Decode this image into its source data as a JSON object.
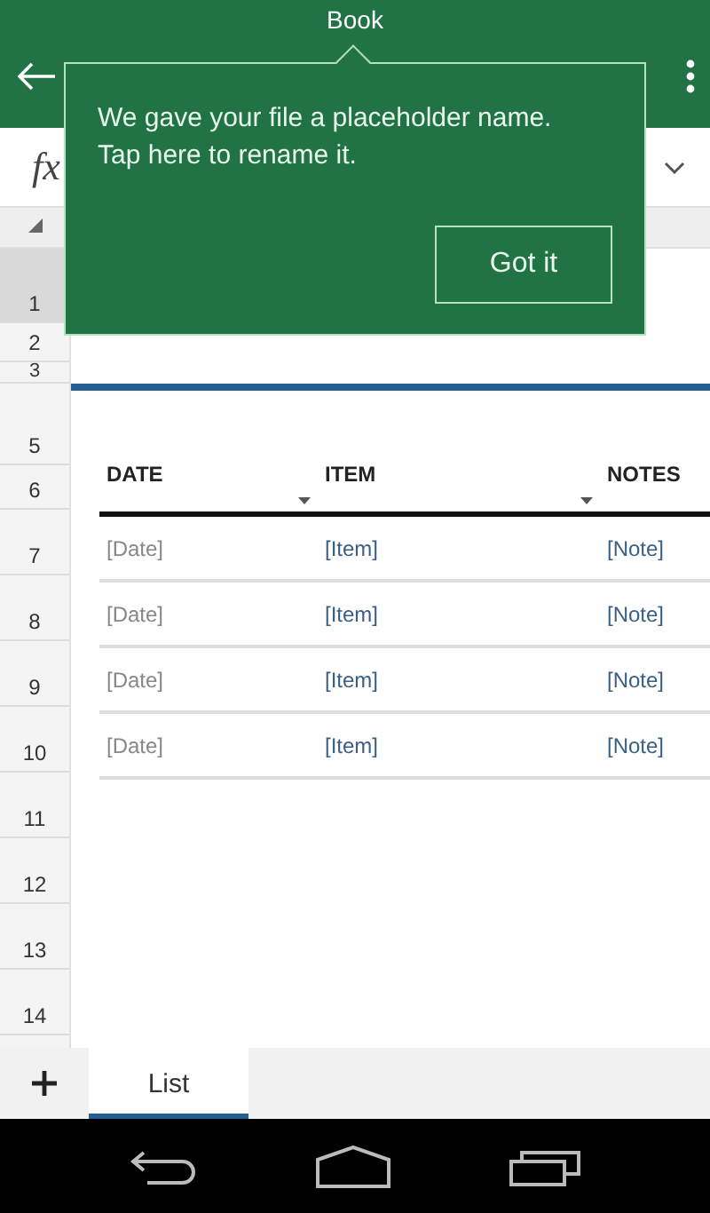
{
  "app_bar": {
    "title": "Book"
  },
  "formula_bar": {
    "function_label": "fx"
  },
  "sheet": {
    "row_headers": [
      {
        "number": "1",
        "selected": true
      },
      {
        "number": "2",
        "selected": false
      },
      {
        "number": "3",
        "selected": false
      },
      {
        "number": "5",
        "selected": false
      },
      {
        "number": "6",
        "selected": false
      },
      {
        "number": "7",
        "selected": false
      },
      {
        "number": "8",
        "selected": false
      },
      {
        "number": "9",
        "selected": false
      },
      {
        "number": "10",
        "selected": false
      },
      {
        "number": "11",
        "selected": false
      },
      {
        "number": "12",
        "selected": false
      },
      {
        "number": "13",
        "selected": false
      },
      {
        "number": "14",
        "selected": false
      }
    ],
    "columns": [
      {
        "label": "DATE",
        "filter_button": true
      },
      {
        "label": "ITEM",
        "filter_button": true
      },
      {
        "label": "NOTES",
        "filter_button": false
      }
    ],
    "rows": [
      [
        "[Date]",
        "[Item]",
        "[Note]"
      ],
      [
        "[Date]",
        "[Item]",
        "[Note]"
      ],
      [
        "[Date]",
        "[Item]",
        "[Note]"
      ],
      [
        "[Date]",
        "[Item]",
        "[Note]"
      ]
    ]
  },
  "sheet_tabs": [
    {
      "label": "List",
      "selected": true
    }
  ],
  "popup": {
    "message": "We gave your file a placeholder name. Tap here to rename it.",
    "button": "Got it"
  }
}
